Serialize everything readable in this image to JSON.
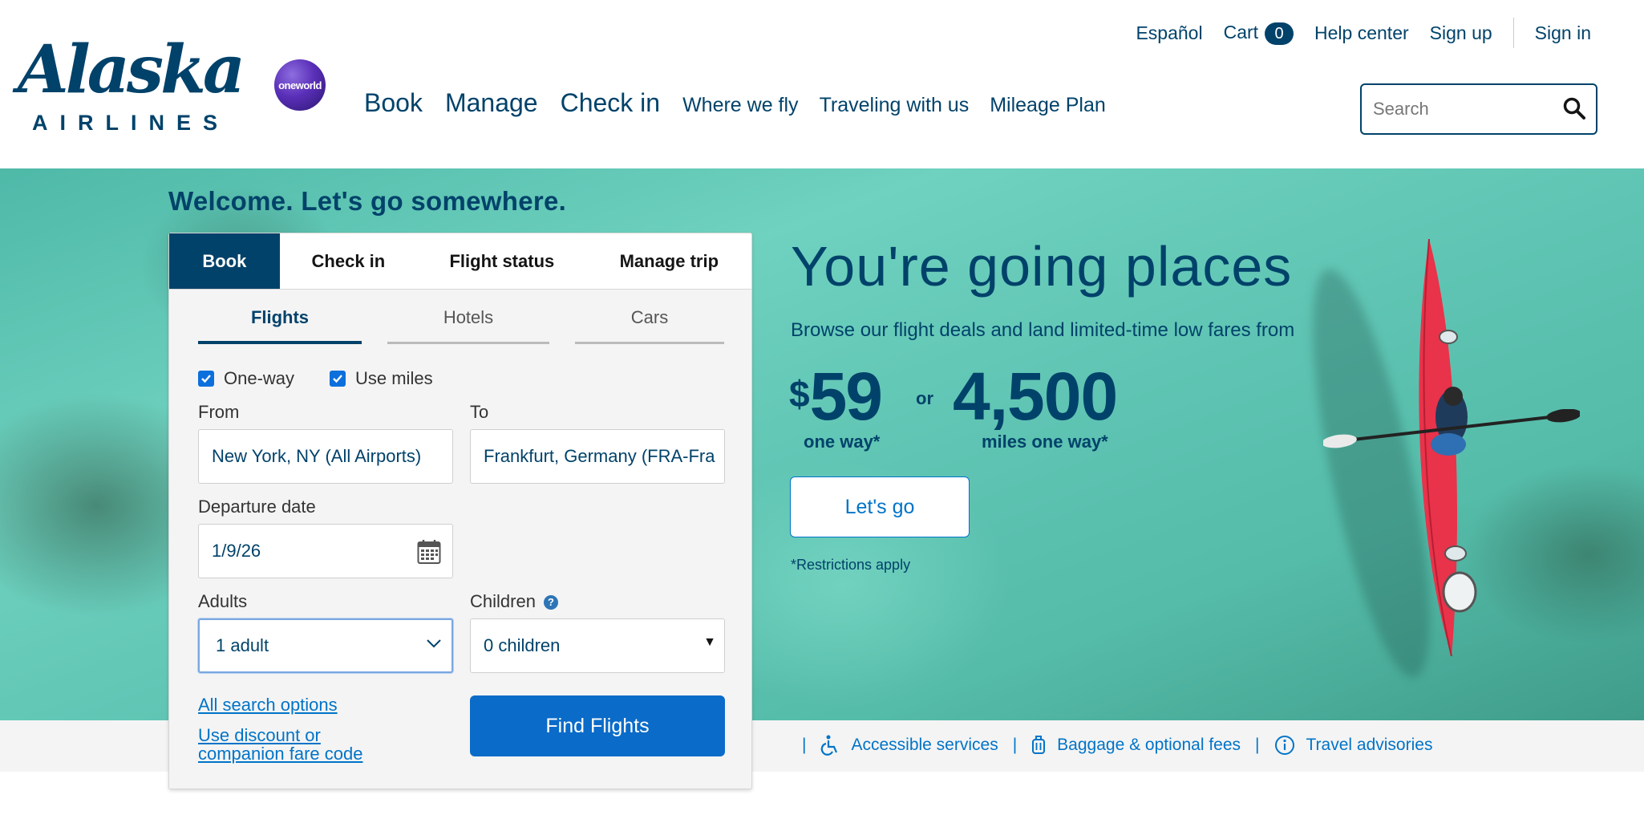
{
  "header": {
    "logo_wordmark": "Alaska",
    "logo_sub": "AIRLINES",
    "oneworld_label": "oneworld",
    "util_nav": {
      "espanol": "Español",
      "cart": "Cart",
      "cart_count": "0",
      "help": "Help center",
      "signup": "Sign up",
      "signin": "Sign in"
    },
    "main_nav": {
      "book": "Book",
      "manage": "Manage",
      "checkin": "Check in",
      "where": "Where we fly",
      "traveling": "Traveling with us",
      "mileage": "Mileage Plan"
    },
    "search_placeholder": "Search"
  },
  "hero": {
    "welcome": "Welcome. Let's go somewhere.",
    "promo_title": "You're going places",
    "promo_sub": "Browse our flight deals and land limited-time low fares from",
    "price_symbol": "$",
    "price_value": "59",
    "price_caption": "one way*",
    "or": "or",
    "miles_value": "4,500",
    "miles_caption": "miles one way*",
    "cta": "Let's go",
    "restrictions": "*Restrictions apply"
  },
  "widget": {
    "tabs": {
      "book": "Book",
      "checkin": "Check in",
      "status": "Flight status",
      "manage": "Manage trip"
    },
    "subtabs": {
      "flights": "Flights",
      "hotels": "Hotels",
      "cars": "Cars"
    },
    "oneway_label": "One-way",
    "oneway_checked": true,
    "miles_label": "Use miles",
    "miles_checked": true,
    "from_label": "From",
    "from_value": "New York, NY (All Airports)",
    "to_label": "To",
    "to_value": "Frankfurt, Germany (FRA-Fra",
    "date_label": "Departure date",
    "date_value": "1/9/26",
    "adults_label": "Adults",
    "adults_value": "1 adult",
    "children_label": "Children",
    "children_value": "0 children",
    "all_options": "All search options",
    "discount_line1": "Use discount or",
    "discount_line2": "companion fare code",
    "find": "Find Flights"
  },
  "strip": {
    "accessible": "Accessible services",
    "baggage": "Baggage & optional fees",
    "advisories": "Travel advisories",
    "separator": "|"
  },
  "colors": {
    "brand_navy": "#01426a",
    "link_blue": "#0074c8",
    "button_blue": "#0a6bc9"
  }
}
